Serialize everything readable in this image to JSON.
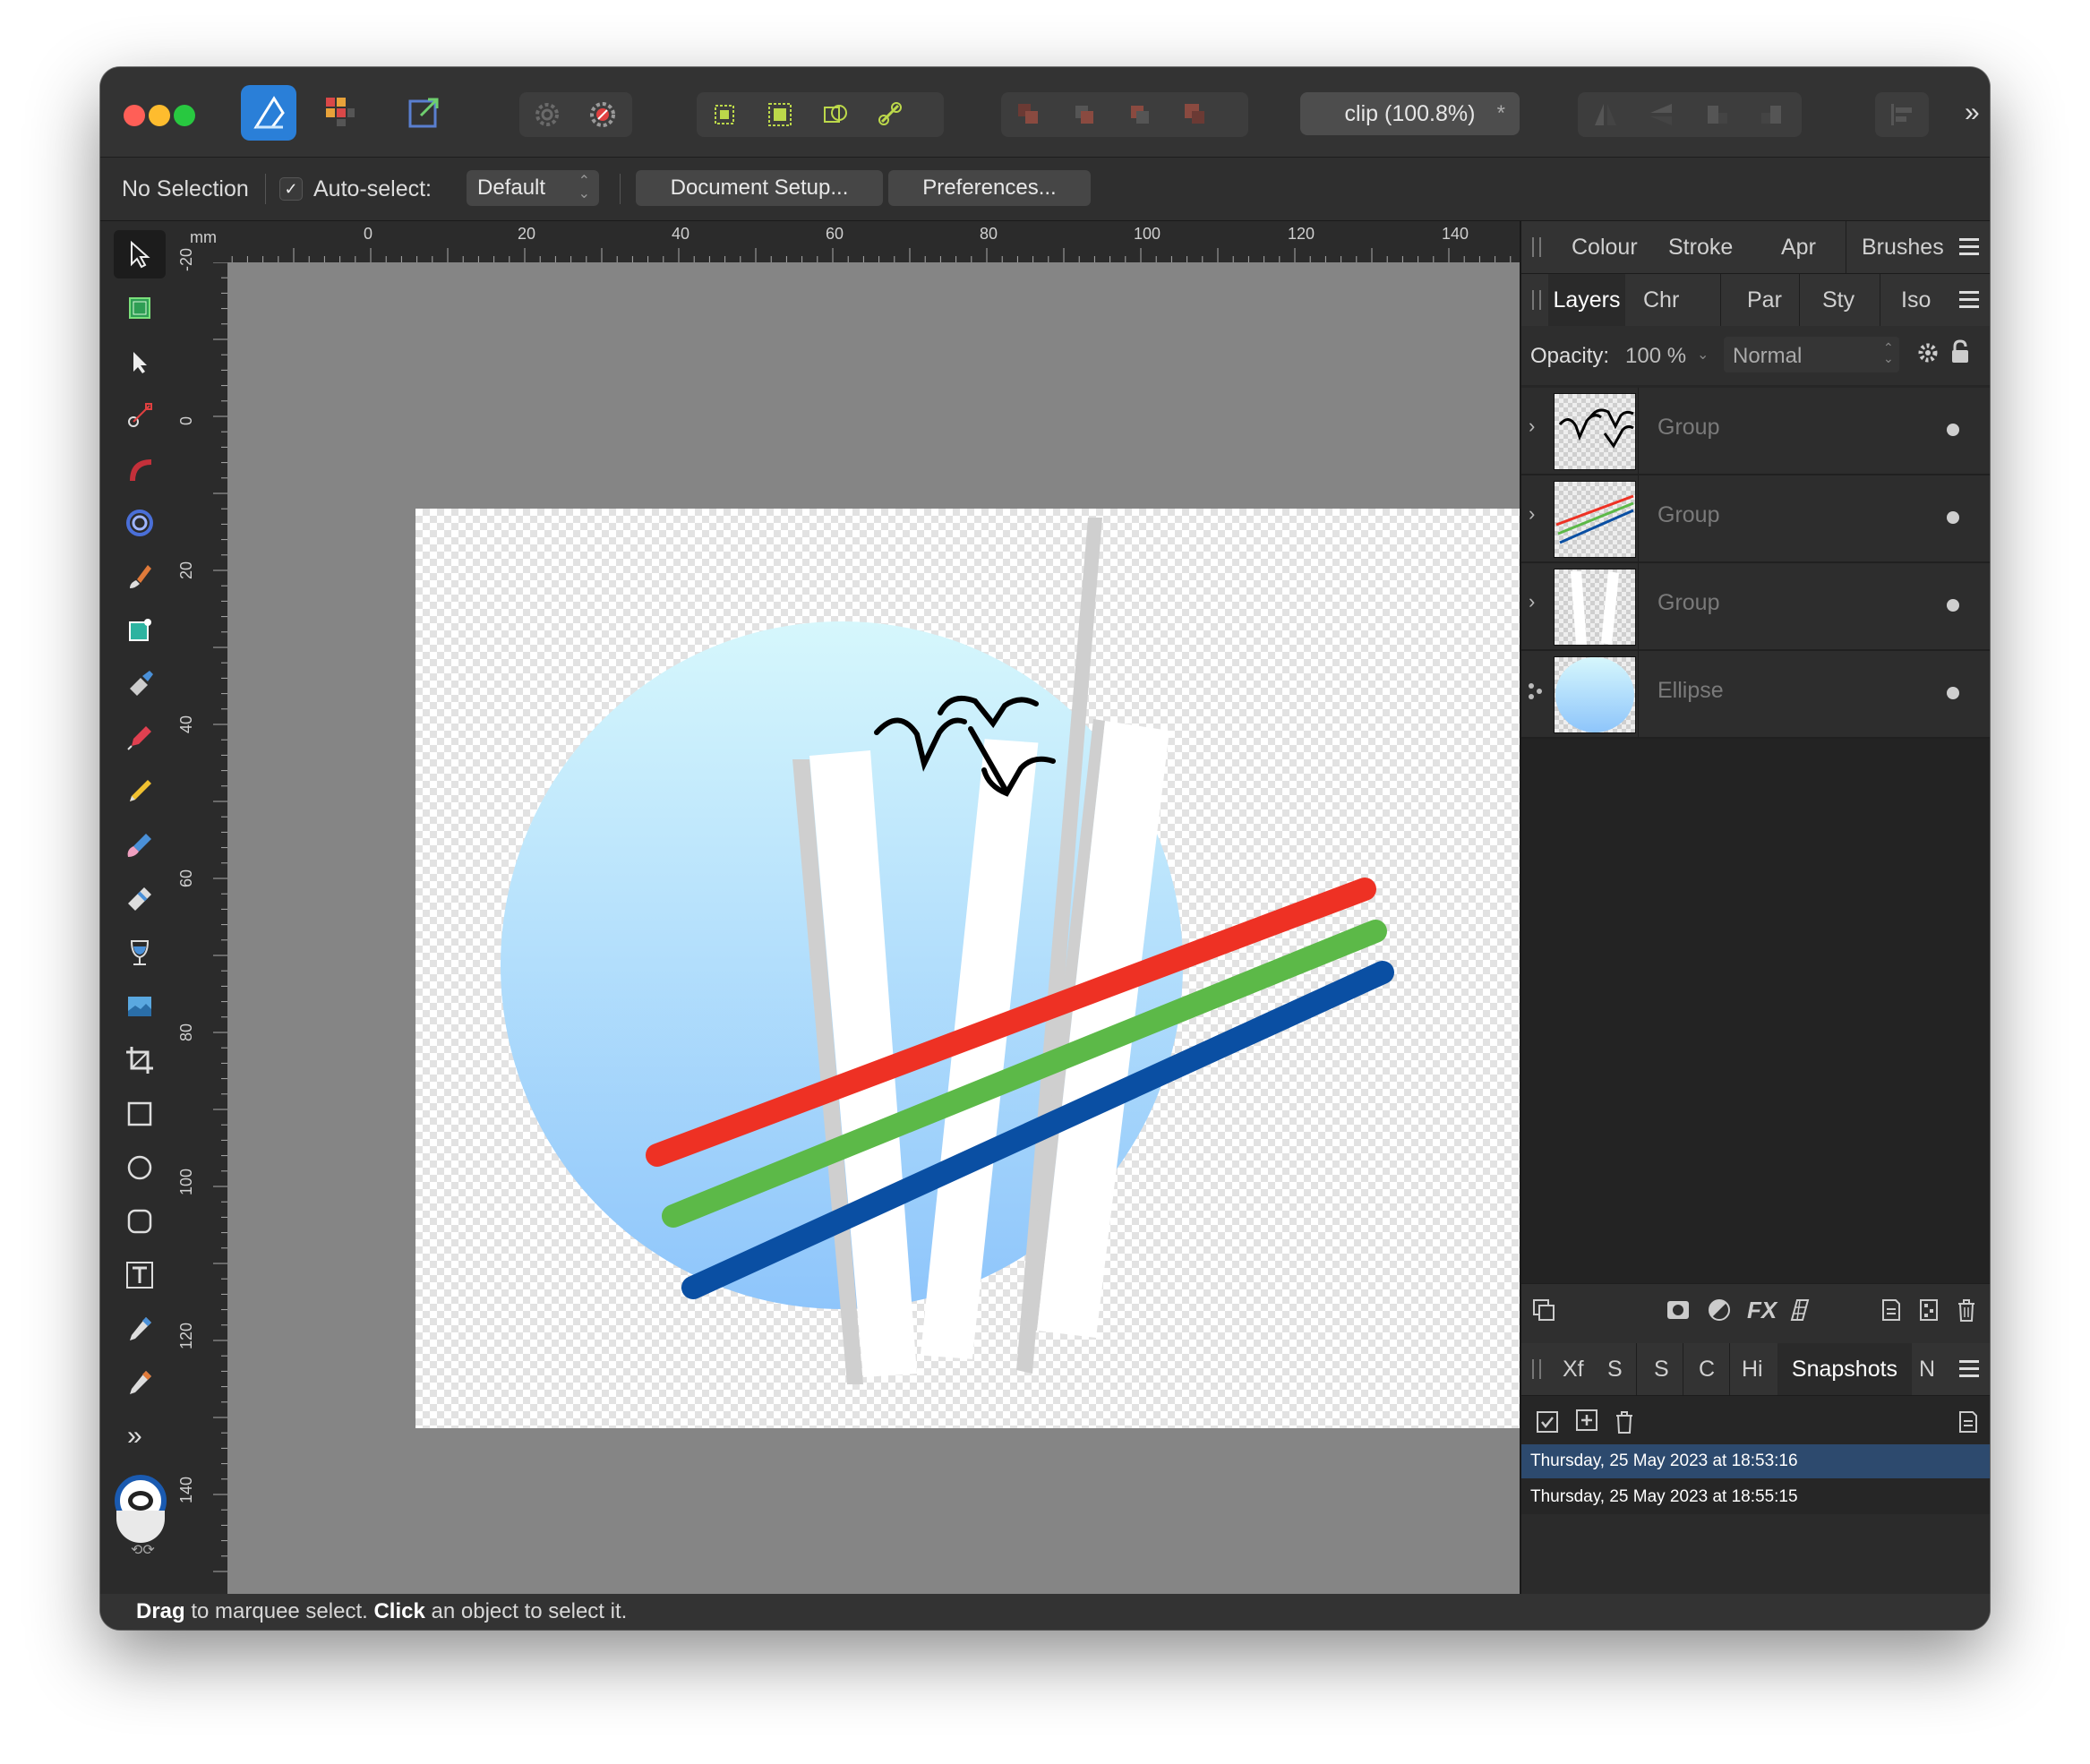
{
  "window": {
    "document_tab": "clip (100.8%)",
    "document_tab_close": "*"
  },
  "context_bar": {
    "selection": "No Selection",
    "auto_select_label": "Auto-select:",
    "auto_select_value": "Default",
    "document_setup": "Document Setup...",
    "preferences": "Preferences..."
  },
  "rulers": {
    "unit": "mm",
    "horizontal_ticks": [
      "0",
      "20",
      "40",
      "60",
      "80",
      "100",
      "120",
      "140"
    ],
    "vertical_ticks": [
      "-20",
      "0",
      "20",
      "40",
      "60",
      "80",
      "100",
      "120",
      "140"
    ]
  },
  "panels": {
    "top_tabs": [
      "Colour",
      "Stroke",
      "Apr",
      "Brushes"
    ],
    "layer_tabs": [
      "Layers",
      "Chr",
      "Par",
      "Sty",
      "Iso"
    ],
    "opacity_label": "Opacity:",
    "opacity_value": "100 %",
    "blend_mode": "Normal",
    "layers": [
      {
        "name": "Group",
        "thumb": "birds"
      },
      {
        "name": "Group",
        "thumb": "lines"
      },
      {
        "name": "Group",
        "thumb": "bars"
      },
      {
        "name": "Ellipse",
        "thumb": "ellipse"
      }
    ],
    "bottom_tabs": [
      "Xf",
      "S",
      "S",
      "C",
      "Hi",
      "Snapshots",
      "N"
    ],
    "snapshots": [
      {
        "label": "Thursday, 25 May 2023 at 18:53:16",
        "selected": true
      },
      {
        "label": "Thursday, 25 May 2023 at 18:55:15",
        "selected": false
      }
    ]
  },
  "status_bar": {
    "drag": "Drag",
    "drag_text": " to marquee select. ",
    "click": "Click",
    "click_text": " an object to select it."
  },
  "colors": {
    "accent_selected": "#2d4a6e",
    "line_red": "#ee3124",
    "line_green": "#5cb948",
    "line_blue": "#0a4fa3"
  }
}
